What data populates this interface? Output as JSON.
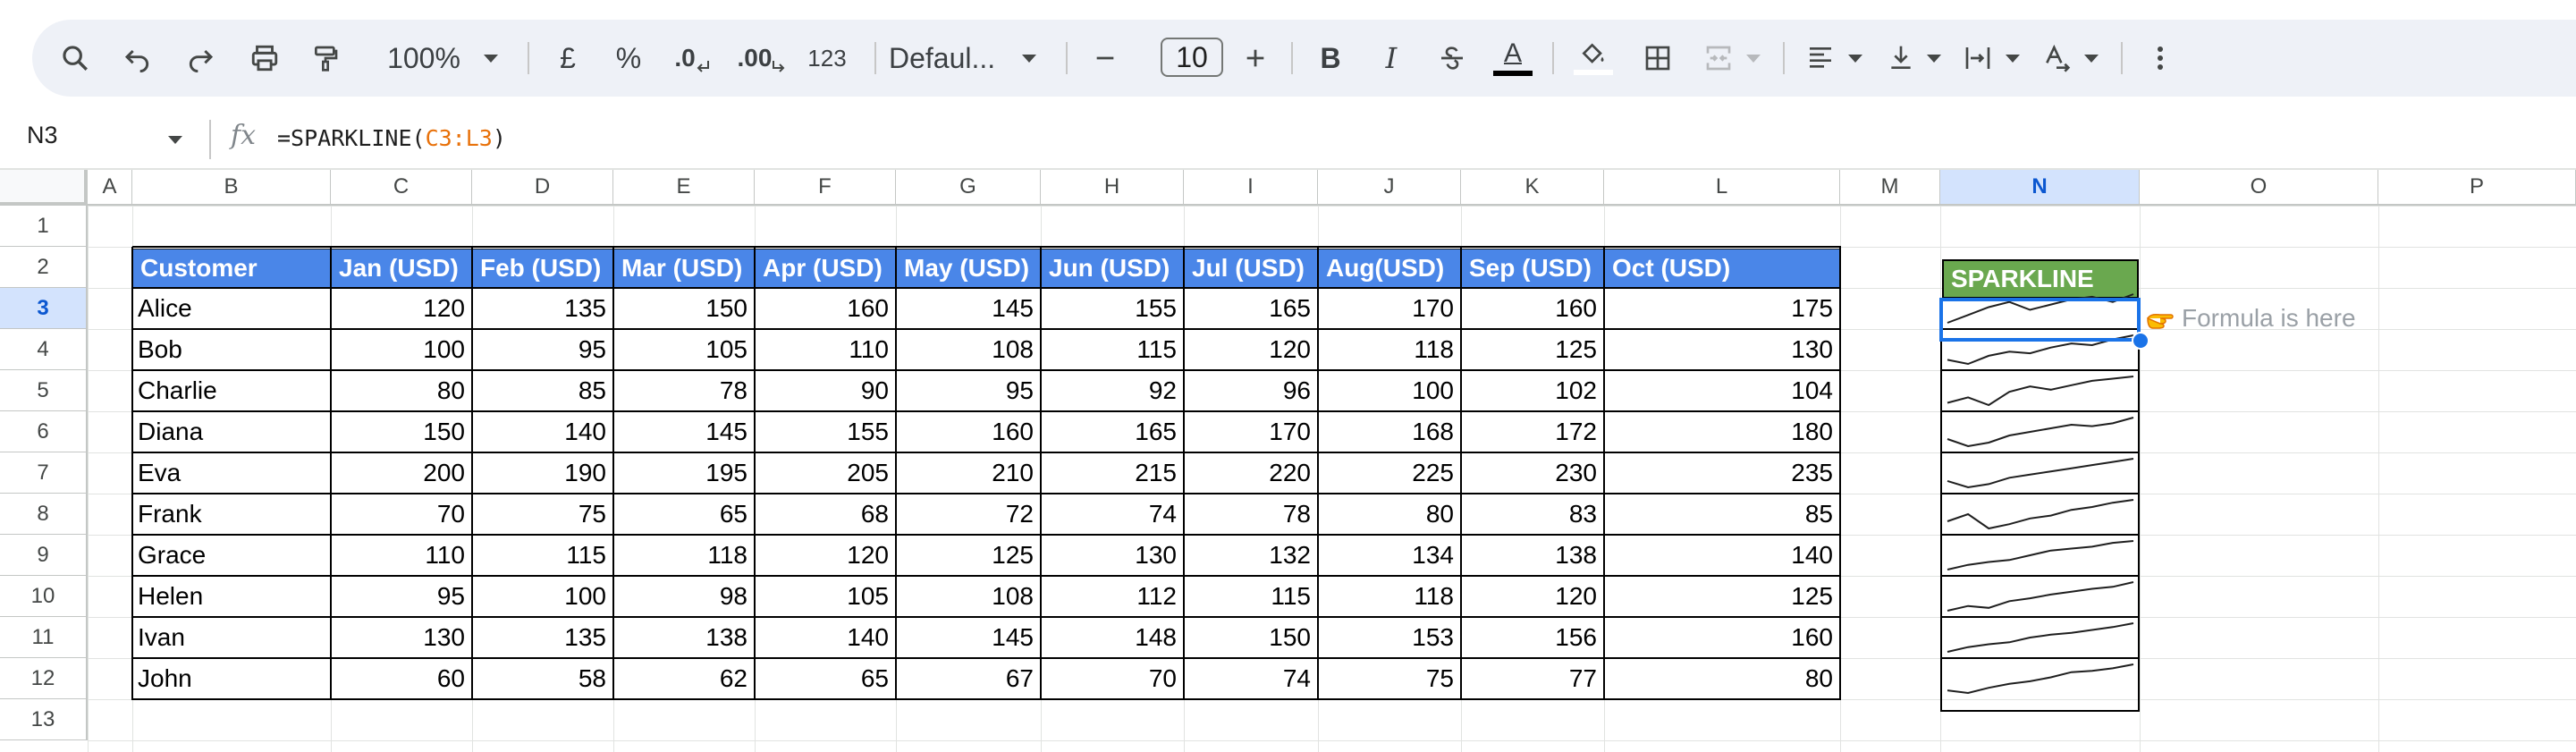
{
  "toolbar": {
    "zoom": "100%",
    "currency": "£",
    "percent": "%",
    "dec_decrease": ".0",
    "dec_increase": ".00",
    "number_format": "123",
    "font": "Defaul...",
    "font_size": "10",
    "bold": "B",
    "italic": "I",
    "text_color": "A"
  },
  "formula_bar": {
    "cell_ref": "N3",
    "formula_prefix": "=SPARKLINE(",
    "formula_range": "C3:L3",
    "formula_suffix": ")"
  },
  "columns": [
    "A",
    "B",
    "C",
    "D",
    "E",
    "F",
    "G",
    "H",
    "I",
    "J",
    "K",
    "L",
    "M",
    "N",
    "O",
    "P"
  ],
  "rows": [
    "1",
    "2",
    "3",
    "4",
    "5",
    "6",
    "7",
    "8",
    "9",
    "10",
    "11",
    "12",
    "13"
  ],
  "selected": {
    "column": "N",
    "row": "3"
  },
  "table": {
    "headers": [
      "Customer",
      "Jan (USD)",
      "Feb (USD)",
      "Mar (USD)",
      "Apr (USD)",
      "May (USD)",
      "Jun (USD)",
      "Jul (USD)",
      "Aug(USD)",
      "Sep (USD)",
      "Oct (USD)"
    ],
    "rows": [
      {
        "name": "Alice",
        "values": [
          120,
          135,
          150,
          160,
          145,
          155,
          165,
          170,
          160,
          175
        ]
      },
      {
        "name": "Bob",
        "values": [
          100,
          95,
          105,
          110,
          108,
          115,
          120,
          118,
          125,
          130
        ]
      },
      {
        "name": "Charlie",
        "values": [
          80,
          85,
          78,
          90,
          95,
          92,
          96,
          100,
          102,
          104
        ]
      },
      {
        "name": "Diana",
        "values": [
          150,
          140,
          145,
          155,
          160,
          165,
          170,
          168,
          172,
          180
        ]
      },
      {
        "name": "Eva",
        "values": [
          200,
          190,
          195,
          205,
          210,
          215,
          220,
          225,
          230,
          235
        ]
      },
      {
        "name": "Frank",
        "values": [
          70,
          75,
          65,
          68,
          72,
          74,
          78,
          80,
          83,
          85
        ]
      },
      {
        "name": "Grace",
        "values": [
          110,
          115,
          118,
          120,
          125,
          130,
          132,
          134,
          138,
          140
        ]
      },
      {
        "name": "Helen",
        "values": [
          95,
          100,
          98,
          105,
          108,
          112,
          115,
          118,
          120,
          125
        ]
      },
      {
        "name": "Ivan",
        "values": [
          130,
          135,
          138,
          140,
          145,
          148,
          150,
          153,
          156,
          160
        ]
      },
      {
        "name": "John",
        "values": [
          60,
          58,
          62,
          65,
          67,
          70,
          74,
          75,
          77,
          80
        ]
      }
    ]
  },
  "sparkline_header": "SPARKLINE",
  "note": {
    "icon": "pointing-hand-icon",
    "text": "Formula is here"
  },
  "colors": {
    "header_blue": "#4a86e8",
    "header_green": "#6aa84f",
    "selection": "#1a73e8",
    "formula_ref": "#e8710a"
  }
}
